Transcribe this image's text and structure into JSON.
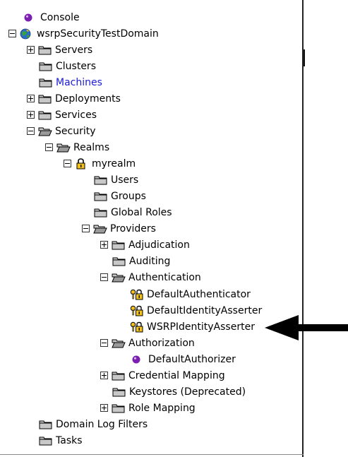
{
  "tree": {
    "console": "Console",
    "domain": "wsrpSecurityTestDomain",
    "servers": "Servers",
    "clusters": "Clusters",
    "machines": "Machines",
    "deployments": "Deployments",
    "services": "Services",
    "security": "Security",
    "realms": "Realms",
    "myrealm": "myrealm",
    "users": "Users",
    "groups": "Groups",
    "global_roles": "Global Roles",
    "providers": "Providers",
    "adjudication": "Adjudication",
    "auditing": "Auditing",
    "authentication": "Authentication",
    "default_authenticator": "DefaultAuthenticator",
    "default_identity_asserter": "DefaultIdentityAsserter",
    "wsrp_identity_asserter": "WSRPIdentityAsserter",
    "authorization": "Authorization",
    "default_authorizer": "DefaultAuthorizer",
    "credential_mapping": "Credential Mapping",
    "keystores": "Keystores (Deprecated)",
    "role_mapping": "Role Mapping",
    "domain_log_filters": "Domain Log Filters",
    "tasks": "Tasks"
  },
  "colors": {
    "link": "#1a1ad6",
    "bullet": "#7a1fb0",
    "folder": "#c8c8c8",
    "arrow": "#000000"
  },
  "icons": {
    "console": "purple-bullet-icon",
    "domain": "globe-icon",
    "folder": "folder-icon",
    "open_folder": "open-folder-icon",
    "realm": "lock-icon",
    "provider": "key-lock-icon",
    "pointer": "arrow-left-icon"
  }
}
